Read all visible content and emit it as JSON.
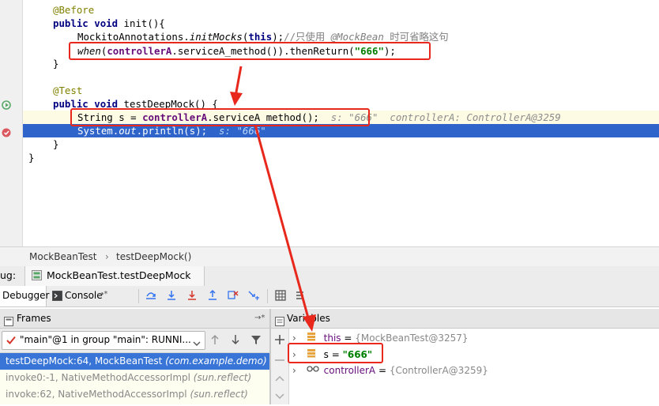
{
  "editor": {
    "lines": {
      "before_annotation": "@Before",
      "init_sig_kw1": "public",
      "init_sig_kw2": "void",
      "init_sig_rest": " init(){",
      "mocks_prefix": "MockitoAnnotations.",
      "mocks_method": "initMocks",
      "mocks_paren_open": "(",
      "mocks_this": "this",
      "mocks_close": ");",
      "mocks_comment_slash": "//只使用 ",
      "mocks_comment_ann": "@MockBean",
      "mocks_comment_rest": " 时可省略这句",
      "when_fn": "when",
      "when_paren": "(",
      "when_field": "controllerA",
      "when_rest": ".serviceA_method()).thenReturn(",
      "when_str": "\"666\"",
      "when_end": ");",
      "close_brace_1": "}",
      "test_annotation": "@Test",
      "test_kw1": "public",
      "test_kw2": "void",
      "test_rest": " testDeepMock() {",
      "assign_type": "String s = ",
      "assign_field": "controllerA",
      "assign_rest": ".serviceA method();",
      "assign_hint": "  s: \"666\"  controllerA: ControllerA@3259",
      "println_prefix": "System.",
      "println_out": "out",
      "println_rest": ".println(s);",
      "println_hint": "  s: \"666\"",
      "close_brace_2": "}",
      "close_brace_3": "}"
    }
  },
  "breadcrumb": {
    "class": "MockBeanTest",
    "sep": "›",
    "method": "testDeepMock()"
  },
  "debug": {
    "label": "ug:",
    "session_tab": "MockBeanTest.testDeepMock",
    "debugger_tab": "Debugger",
    "console_tab": "Console",
    "console_arrow": "→*"
  },
  "frames": {
    "title": "Frames",
    "pin": "→*",
    "thread_select": "\"main\"@1 in group \"main\": RUNNI...",
    "items": [
      {
        "method": "testDeepMock:64, MockBeanTest ",
        "pkg": "(com.example.demo)"
      },
      {
        "method": "invoke0:-1, NativeMethodAccessorImpl ",
        "pkg": "(sun.reflect)"
      },
      {
        "method": "invoke:62, NativeMethodAccessorImpl ",
        "pkg": "(sun.reflect)"
      }
    ]
  },
  "variables": {
    "title": "Variables",
    "rows": [
      {
        "name": "this",
        "eq": " = ",
        "value": "{MockBeanTest@3257}"
      },
      {
        "name": "s",
        "eq": " = ",
        "value": "\"666\""
      },
      {
        "name": "controllerA",
        "eq": " = ",
        "value": "{ControllerA@3259}"
      }
    ]
  },
  "colors": {
    "accent_red": "#e8281c",
    "selection_blue": "#2f65ca",
    "frame_selected": "#3875d7"
  }
}
